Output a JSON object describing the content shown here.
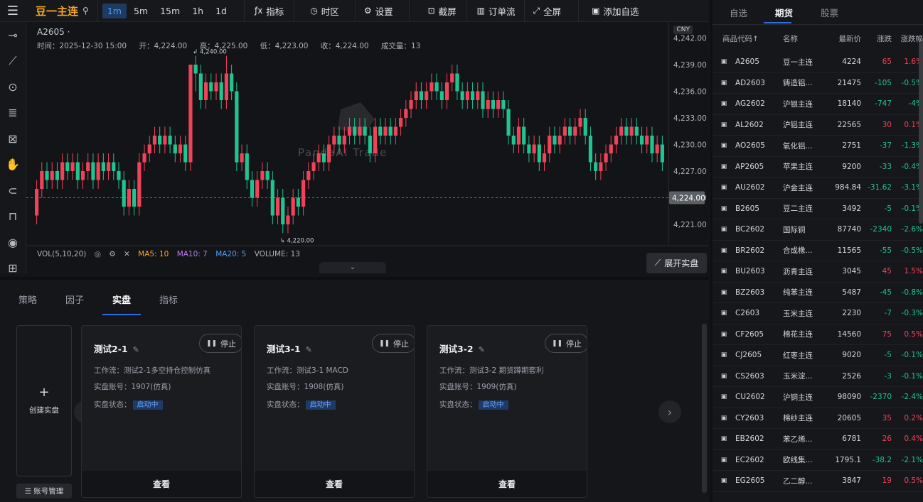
{
  "topbar": {
    "symbol": "豆一主连",
    "timeframes": [
      "1m",
      "5m",
      "15m",
      "1h",
      "1d"
    ],
    "active_timeframe": "1m",
    "tools": {
      "indicator": "指标",
      "timezone": "时区",
      "settings": "设置",
      "screenshot": "截屏",
      "orderflow": "订单流",
      "fullscreen": "全屏",
      "add_watch": "添加自选"
    }
  },
  "chart": {
    "code": "A2605 ·",
    "time": "时间：2025-12-30 15:00",
    "open": "开：4,224.00",
    "high": "高：4,225.00",
    "low": "低：4,223.00",
    "close": "收：4,224.00",
    "volume": "成交量：13",
    "currency": "CNY",
    "watermark": "PandaAI Trade",
    "high_mark": "4,240.00",
    "low_mark": "4,220.00",
    "last_price_label": "4,224.00",
    "y_ticks": [
      "4,242.00",
      "4,239.00",
      "4,236.00",
      "4,233.00",
      "4,230.00",
      "4,227.00",
      "4,224.00",
      "4,221.00"
    ],
    "vol_label": "VOL(5,10,20)",
    "ma5": "MA5: 10",
    "ma10": "MA10: 7",
    "ma20": "MA20: 5",
    "vol_value": "VOLUME: 13",
    "expand_live": "展开实盘",
    "colors": {
      "up": "#f0435a",
      "down": "#1fc48f",
      "accent": "#2f6fe0"
    }
  },
  "chart_data": {
    "type": "candlestick",
    "symbol": "A2605",
    "ylim": [
      4219,
      4243
    ],
    "y_ticks": [
      4242,
      4239,
      4236,
      4233,
      4230,
      4227,
      4224,
      4221
    ],
    "last_close": 4224,
    "high_mark": 4240,
    "low_mark": 4220,
    "candles": [
      [
        4222,
        4225,
        4221,
        4226
      ],
      [
        4225,
        4227,
        4224,
        4228
      ],
      [
        4227,
        4226,
        4225,
        4228
      ],
      [
        4226,
        4227,
        4225,
        4228
      ],
      [
        4227,
        4226,
        4225,
        4228
      ],
      [
        4226,
        4228,
        4225,
        4229
      ],
      [
        4228,
        4227,
        4226,
        4229
      ],
      [
        4227,
        4228,
        4226,
        4229
      ],
      [
        4228,
        4226,
        4225,
        4229
      ],
      [
        4226,
        4227,
        4225,
        4228
      ],
      [
        4227,
        4228,
        4226,
        4229
      ],
      [
        4228,
        4226,
        4225,
        4229
      ],
      [
        4226,
        4228,
        4225,
        4229
      ],
      [
        4228,
        4227,
        4226,
        4229
      ],
      [
        4227,
        4228,
        4226,
        4229
      ],
      [
        4228,
        4227,
        4226,
        4229
      ],
      [
        4227,
        4226,
        4225,
        4228
      ],
      [
        4226,
        4223,
        4222,
        4227
      ],
      [
        4223,
        4225,
        4222,
        4226
      ],
      [
        4225,
        4223,
        4222,
        4226
      ],
      [
        4223,
        4228,
        4222,
        4229
      ],
      [
        4228,
        4229,
        4227,
        4230
      ],
      [
        4229,
        4230,
        4228,
        4231
      ],
      [
        4230,
        4231,
        4229,
        4232
      ],
      [
        4231,
        4230,
        4229,
        4232
      ],
      [
        4230,
        4231,
        4229,
        4232
      ],
      [
        4231,
        4230,
        4229,
        4232
      ],
      [
        4230,
        4229,
        4228,
        4231
      ],
      [
        4229,
        4230,
        4228,
        4231
      ],
      [
        4230,
        4228,
        4227,
        4231
      ],
      [
        4228,
        4239,
        4227,
        4239
      ],
      [
        4239,
        4238,
        4236,
        4240
      ],
      [
        4238,
        4235,
        4234,
        4239
      ],
      [
        4235,
        4237,
        4234,
        4238
      ],
      [
        4237,
        4236,
        4235,
        4238
      ],
      [
        4236,
        4237,
        4235,
        4238
      ],
      [
        4237,
        4235,
        4234,
        4238
      ],
      [
        4235,
        4238,
        4234,
        4240
      ],
      [
        4238,
        4236,
        4235,
        4239
      ],
      [
        4236,
        4228,
        4227,
        4237
      ],
      [
        4228,
        4229,
        4227,
        4230
      ],
      [
        4229,
        4226,
        4225,
        4230
      ],
      [
        4226,
        4224,
        4223,
        4227
      ],
      [
        4224,
        4226,
        4223,
        4227
      ],
      [
        4226,
        4227,
        4225,
        4228
      ],
      [
        4227,
        4226,
        4225,
        4228
      ],
      [
        4226,
        4222,
        4221,
        4227
      ],
      [
        4222,
        4224,
        4221,
        4225
      ],
      [
        4224,
        4221,
        4220,
        4225
      ],
      [
        4221,
        4222,
        4220,
        4223
      ],
      [
        4222,
        4224,
        4221,
        4225
      ],
      [
        4224,
        4223,
        4222,
        4225
      ],
      [
        4223,
        4226,
        4222,
        4227
      ],
      [
        4226,
        4227,
        4225,
        4228
      ],
      [
        4227,
        4228,
        4226,
        4229
      ],
      [
        4228,
        4229,
        4227,
        4230
      ],
      [
        4229,
        4228,
        4227,
        4230
      ],
      [
        4228,
        4230,
        4227,
        4231
      ],
      [
        4230,
        4231,
        4229,
        4232
      ],
      [
        4231,
        4230,
        4229,
        4232
      ],
      [
        4230,
        4231,
        4229,
        4232
      ],
      [
        4231,
        4232,
        4230,
        4233
      ],
      [
        4232,
        4231,
        4230,
        4233
      ],
      [
        4231,
        4232,
        4230,
        4233
      ],
      [
        4232,
        4231,
        4230,
        4233
      ],
      [
        4231,
        4229,
        4228,
        4232
      ],
      [
        4229,
        4232,
        4228,
        4233
      ],
      [
        4232,
        4231,
        4230,
        4233
      ],
      [
        4231,
        4232,
        4230,
        4233
      ],
      [
        4232,
        4231,
        4230,
        4233
      ],
      [
        4231,
        4232,
        4230,
        4233
      ],
      [
        4232,
        4233,
        4231,
        4234
      ],
      [
        4233,
        4234,
        4232,
        4235
      ],
      [
        4234,
        4235,
        4233,
        4236
      ],
      [
        4235,
        4236,
        4234,
        4237
      ],
      [
        4236,
        4235,
        4234,
        4237
      ],
      [
        4235,
        4236,
        4234,
        4237
      ],
      [
        4236,
        4237,
        4235,
        4238
      ],
      [
        4237,
        4236,
        4235,
        4238
      ],
      [
        4236,
        4235,
        4234,
        4237
      ],
      [
        4235,
        4237,
        4234,
        4238
      ],
      [
        4237,
        4238,
        4236,
        4239
      ],
      [
        4238,
        4236,
        4235,
        4239
      ],
      [
        4236,
        4235,
        4234,
        4237
      ],
      [
        4235,
        4236,
        4234,
        4237
      ],
      [
        4236,
        4235,
        4234,
        4237
      ],
      [
        4235,
        4236,
        4234,
        4237
      ],
      [
        4236,
        4234,
        4233,
        4237
      ],
      [
        4234,
        4235,
        4233,
        4236
      ],
      [
        4235,
        4234,
        4233,
        4236
      ],
      [
        4234,
        4235,
        4233,
        4236
      ],
      [
        4235,
        4234,
        4233,
        4236
      ],
      [
        4234,
        4231,
        4230,
        4235
      ],
      [
        4231,
        4230,
        4229,
        4232
      ],
      [
        4230,
        4232,
        4229,
        4233
      ],
      [
        4232,
        4230,
        4229,
        4233
      ],
      [
        4230,
        4229,
        4228,
        4231
      ],
      [
        4229,
        4230,
        4228,
        4231
      ],
      [
        4230,
        4228,
        4227,
        4231
      ],
      [
        4228,
        4229,
        4227,
        4230
      ],
      [
        4229,
        4231,
        4228,
        4232
      ],
      [
        4231,
        4230,
        4229,
        4232
      ],
      [
        4230,
        4231,
        4229,
        4232
      ],
      [
        4231,
        4232,
        4230,
        4233
      ],
      [
        4232,
        4231,
        4230,
        4233
      ],
      [
        4231,
        4232,
        4230,
        4233
      ],
      [
        4232,
        4233,
        4231,
        4234
      ],
      [
        4233,
        4231,
        4230,
        4234
      ],
      [
        4231,
        4228,
        4227,
        4232
      ],
      [
        4228,
        4227,
        4226,
        4229
      ],
      [
        4227,
        4228,
        4226,
        4229
      ],
      [
        4228,
        4229,
        4227,
        4230
      ],
      [
        4229,
        4230,
        4228,
        4231
      ],
      [
        4230,
        4231,
        4229,
        4232
      ],
      [
        4231,
        4232,
        4230,
        4233
      ],
      [
        4232,
        4231,
        4230,
        4233
      ],
      [
        4231,
        4232,
        4230,
        4233
      ],
      [
        4232,
        4231,
        4230,
        4233
      ],
      [
        4231,
        4230,
        4229,
        4232
      ],
      [
        4230,
        4231,
        4229,
        4232
      ],
      [
        4231,
        4229,
        4228,
        4232
      ],
      [
        4229,
        4230,
        4228,
        4231
      ],
      [
        4230,
        4228,
        4227,
        4231
      ]
    ]
  },
  "bottom": {
    "tabs": [
      "策略",
      "因子",
      "实盘",
      "指标"
    ],
    "active_tab": "实盘",
    "create_label": "创建实盘",
    "account_mgmt": "账号管理",
    "cards": [
      {
        "title": "测试2-1",
        "stop": "停止",
        "workflow": "工作流：测试2-1多空持仓控制仿真",
        "account": "实盘账号：1907(仿真)",
        "status_label": "实盘状态：",
        "status": "启动中",
        "view": "查看"
      },
      {
        "title": "测试3-1",
        "stop": "停止",
        "workflow": "工作流：测试3-1 MACD",
        "account": "实盘账号：1908(仿真)",
        "status_label": "实盘状态：",
        "status": "启动中",
        "view": "查看"
      },
      {
        "title": "测试3-2",
        "stop": "停止",
        "workflow": "工作流：测试3-2 期货蹲期套利",
        "account": "实盘账号：1909(仿真)",
        "status_label": "实盘状态：",
        "status": "启动中",
        "view": "查看"
      }
    ]
  },
  "watchlist": {
    "tabs": [
      "自选",
      "期货",
      "股票"
    ],
    "active_tab": "期货",
    "headers": {
      "code": "商品代码↑",
      "name": "名称",
      "price": "最新价",
      "chg": "涨跌",
      "pct": "涨跌幅"
    },
    "rows": [
      {
        "code": "A2605",
        "name": "豆一主连",
        "price": "4224",
        "chg": "65",
        "pct": "1.6%",
        "dir": "up"
      },
      {
        "code": "AD2603",
        "name": "铸造铝...",
        "price": "21475",
        "chg": "-105",
        "pct": "-0.5%",
        "dir": "down"
      },
      {
        "code": "AG2602",
        "name": "沪银主连",
        "price": "18140",
        "chg": "-747",
        "pct": "-4%",
        "dir": "down"
      },
      {
        "code": "AL2602",
        "name": "沪铝主连",
        "price": "22565",
        "chg": "30",
        "pct": "0.1%",
        "dir": "up"
      },
      {
        "code": "AO2605",
        "name": "氧化铝...",
        "price": "2751",
        "chg": "-37",
        "pct": "-1.3%",
        "dir": "down"
      },
      {
        "code": "AP2605",
        "name": "苹果主连",
        "price": "9200",
        "chg": "-33",
        "pct": "-0.4%",
        "dir": "down"
      },
      {
        "code": "AU2602",
        "name": "沪金主连",
        "price": "984.84",
        "chg": "-31.62",
        "pct": "-3.1%",
        "dir": "down"
      },
      {
        "code": "B2605",
        "name": "豆二主连",
        "price": "3492",
        "chg": "-5",
        "pct": "-0.1%",
        "dir": "down"
      },
      {
        "code": "BC2602",
        "name": "国际铜",
        "price": "87740",
        "chg": "-2340",
        "pct": "-2.6%",
        "dir": "down"
      },
      {
        "code": "BR2602",
        "name": "合成橡...",
        "price": "11565",
        "chg": "-55",
        "pct": "-0.5%",
        "dir": "down"
      },
      {
        "code": "BU2603",
        "name": "沥青主连",
        "price": "3045",
        "chg": "45",
        "pct": "1.5%",
        "dir": "up"
      },
      {
        "code": "BZ2603",
        "name": "纯苯主连",
        "price": "5487",
        "chg": "-45",
        "pct": "-0.8%",
        "dir": "down"
      },
      {
        "code": "C2603",
        "name": "玉米主连",
        "price": "2230",
        "chg": "-7",
        "pct": "-0.3%",
        "dir": "down"
      },
      {
        "code": "CF2605",
        "name": "棉花主连",
        "price": "14560",
        "chg": "75",
        "pct": "0.5%",
        "dir": "up"
      },
      {
        "code": "CJ2605",
        "name": "红枣主连",
        "price": "9020",
        "chg": "-5",
        "pct": "-0.1%",
        "dir": "down"
      },
      {
        "code": "CS2603",
        "name": "玉米淀...",
        "price": "2526",
        "chg": "-3",
        "pct": "-0.1%",
        "dir": "down"
      },
      {
        "code": "CU2602",
        "name": "沪铜主连",
        "price": "98090",
        "chg": "-2370",
        "pct": "-2.4%",
        "dir": "down"
      },
      {
        "code": "CY2603",
        "name": "棉纱主连",
        "price": "20605",
        "chg": "35",
        "pct": "0.2%",
        "dir": "up"
      },
      {
        "code": "EB2602",
        "name": "苯乙烯...",
        "price": "6781",
        "chg": "26",
        "pct": "0.4%",
        "dir": "up"
      },
      {
        "code": "EC2602",
        "name": "欧线集...",
        "price": "1795.1",
        "chg": "-38.2",
        "pct": "-2.1%",
        "dir": "down"
      },
      {
        "code": "EG2605",
        "name": "乙二醇...",
        "price": "3847",
        "chg": "19",
        "pct": "0.5%",
        "dir": "up"
      }
    ]
  }
}
